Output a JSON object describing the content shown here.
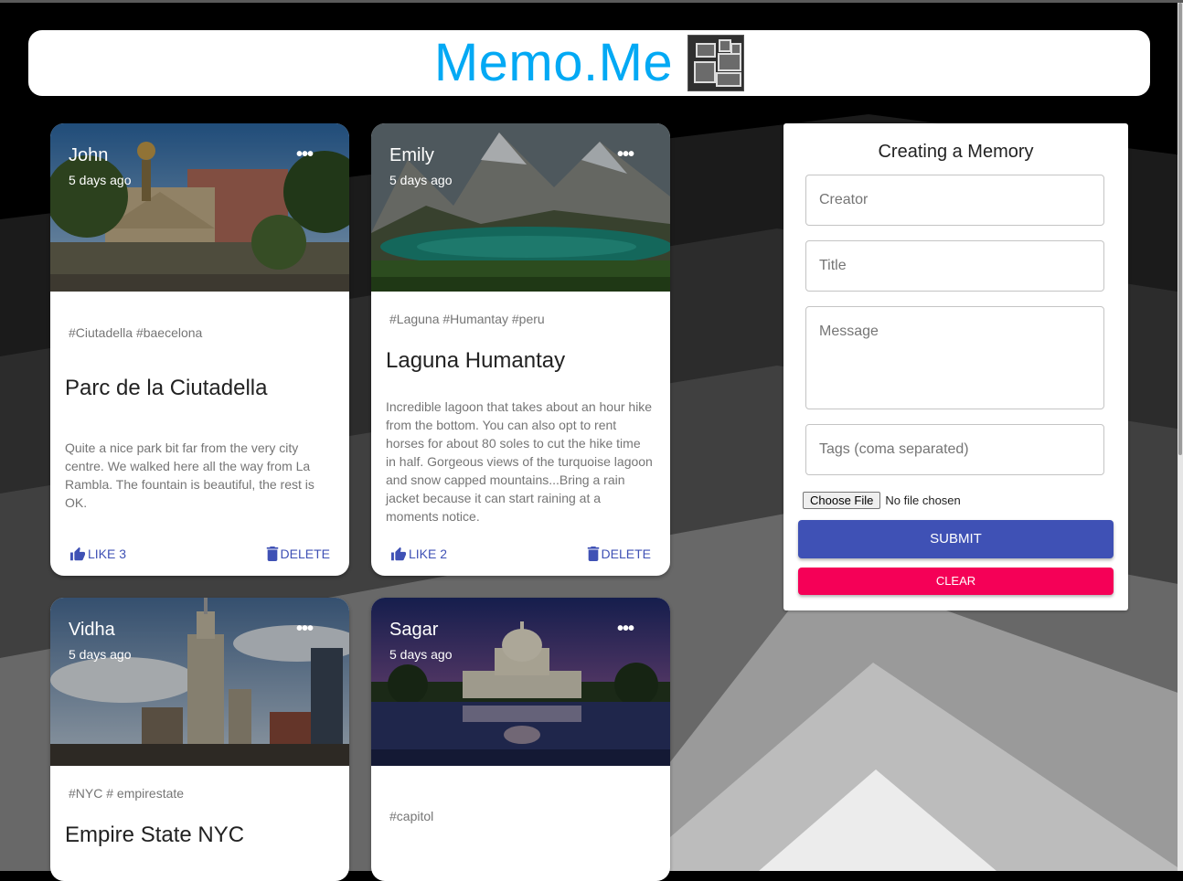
{
  "app": {
    "brand": "Memo.Me"
  },
  "posts": [
    {
      "creator": "John",
      "time": "5 days ago",
      "tags": "#Ciutadella #baecelona",
      "title": "Parc de la Ciutadella",
      "message": "Quite a nice park bit far from the very city centre. We walked here all the way from La Rambla. The fountain is beautiful, the rest is OK.",
      "like_label": "LIKE 3",
      "delete_label": "DELETE"
    },
    {
      "creator": "Emily",
      "time": "5 days ago",
      "tags": "#Laguna #Humantay #peru",
      "title": "Laguna Humantay",
      "message": "Incredible lagoon that takes about an hour hike from the bottom. You can also opt to rent horses for about 80 soles to cut the hike time in half. Gorgeous views of the turquoise lagoon and snow capped mountains...Bring a rain jacket because it can start raining at a moments notice.",
      "like_label": "LIKE 2",
      "delete_label": "DELETE"
    },
    {
      "creator": "Vidha",
      "time": "5 days ago",
      "tags": "#NYC # empirestate",
      "title": "Empire State NYC"
    },
    {
      "creator": "Sagar",
      "time": "5 days ago",
      "tags": "#capitol"
    }
  ],
  "form": {
    "heading": "Creating a Memory",
    "creator_placeholder": "Creator",
    "title_placeholder": "Title",
    "message_placeholder": "Message",
    "tags_placeholder": "Tags (coma separated)",
    "file_button": "Choose File",
    "file_status": "No file chosen",
    "submit_label": "SUBMIT",
    "clear_label": "CLEAR"
  },
  "colors": {
    "brand": "#03a9f4",
    "primary": "#3f51b5",
    "secondary": "#f50057",
    "background": "#000000"
  },
  "icons": {
    "more": "more-horiz-icon",
    "like": "thumb-up-icon",
    "delete": "trash-icon",
    "logo": "photo-frames-icon"
  }
}
